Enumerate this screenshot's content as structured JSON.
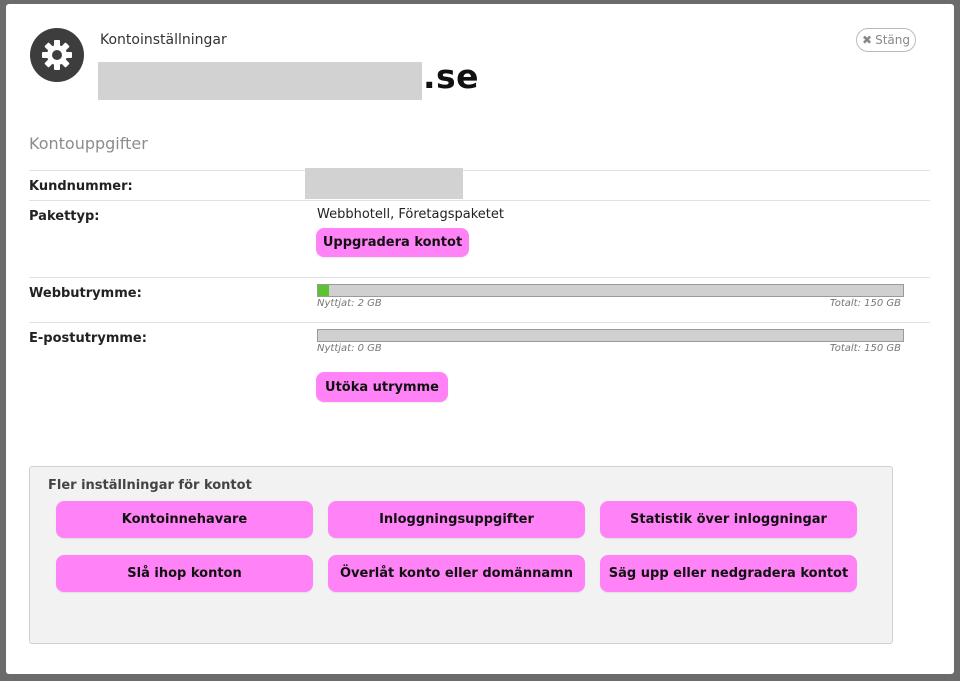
{
  "dialog": {
    "title": "Kontoinställningar",
    "domain_suffix": ".se",
    "close_label": "Stäng"
  },
  "section": {
    "title": "Kontouppgifter"
  },
  "fields": {
    "customer_number_label": "Kundnummer:",
    "package_label": "Pakettyp:",
    "package_value": "Webbhotell, Företagspaketet",
    "upgrade_button": "Uppgradera kontot",
    "web_storage_label": "Webbutrymme:",
    "web_storage_used": "Nyttjat: 2 GB",
    "web_storage_total": "Totalt: 150 GB",
    "web_storage_fraction": 0.0133,
    "email_storage_label": "E-postutrymme:",
    "email_storage_used": "Nyttjat: 0 GB",
    "email_storage_total": "Totalt: 150 GB",
    "email_storage_fraction": 0,
    "expand_button": "Utöka utrymme"
  },
  "more_settings": {
    "title": "Fler inställningar för kontot",
    "buttons": [
      "Kontoinnehavare",
      "Inloggningsuppgifter",
      "Statistik över inloggningar",
      "Slå ihop konton",
      "Överlåt konto eller domännamn",
      "Säg upp eller nedgradera kontot"
    ]
  },
  "colors": {
    "accent_button": "#ff82f6",
    "storage_fill": "#5bc232"
  },
  "icons": {
    "header": "gear-icon",
    "close": "close-icon"
  }
}
